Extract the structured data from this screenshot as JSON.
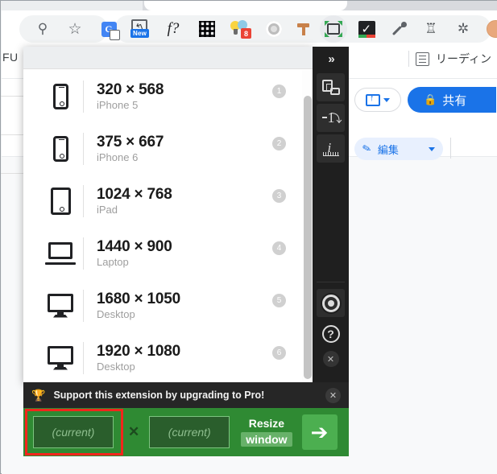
{
  "browser": {
    "toolbar_icons": [
      {
        "name": "search-icon",
        "glyph": "⌕"
      },
      {
        "name": "bookmark-star-icon",
        "glyph": "☆"
      },
      {
        "name": "google-translate-extension-icon",
        "label": "G"
      },
      {
        "name": "screenshot-extension-icon",
        "badge": "New"
      },
      {
        "name": "formula-extension-icon",
        "label": "f?"
      },
      {
        "name": "qr-code-extension-icon"
      },
      {
        "name": "lightbulb-extension-icon",
        "badge": "8"
      },
      {
        "name": "gear-extension-icon"
      },
      {
        "name": "hammer-extension-icon"
      },
      {
        "name": "window-resizer-extension-icon"
      },
      {
        "name": "checkmark-extension-icon"
      },
      {
        "name": "color-picker-extension-icon"
      },
      {
        "name": "clawmark-extension-icon"
      },
      {
        "name": "extensions-puzzle-icon"
      },
      {
        "name": "profile-avatar-icon"
      }
    ]
  },
  "page": {
    "left_label": "FU",
    "reading_list_label": "リーディン",
    "share_label": "共有",
    "share_lock_icon": "🔒",
    "edit_label": "編集",
    "edit_pencil_icon": "✎"
  },
  "popup": {
    "resolutions": [
      {
        "dimensions": "320 × 568",
        "device": "iPhone 5",
        "badge": "1",
        "icon": "phone-icon"
      },
      {
        "dimensions": "375 × 667",
        "device": "iPhone 6",
        "badge": "2",
        "icon": "phone-icon"
      },
      {
        "dimensions": "1024 × 768",
        "device": "iPad",
        "badge": "3",
        "icon": "tablet-icon"
      },
      {
        "dimensions": "1440 × 900",
        "device": "Laptop",
        "badge": "4",
        "icon": "laptop-icon"
      },
      {
        "dimensions": "1680 × 1050",
        "device": "Desktop",
        "badge": "5",
        "icon": "desktop-icon"
      },
      {
        "dimensions": "1920 × 1080",
        "device": "Desktop",
        "badge": "6",
        "icon": "desktop-icon"
      }
    ]
  },
  "side_toolbar": {
    "expand_label": "»",
    "buttons": [
      {
        "name": "arrange-windows-button"
      },
      {
        "name": "redirect-button"
      },
      {
        "name": "info-ruler-button"
      },
      {
        "name": "settings-gear-button"
      },
      {
        "name": "help-button"
      }
    ],
    "close_label": "✕"
  },
  "promo": {
    "trophy_icon": "🏆",
    "message": "Support this extension by upgrading to Pro!",
    "close_label": "✕"
  },
  "resize_bar": {
    "width_value": "(current)",
    "height_value": "(current)",
    "separator": "✕",
    "resize_label_top": "Resize",
    "resize_label_bottom": "window",
    "apply_icon": "➔",
    "highlight_color": "#f2261c",
    "bar_color": "#2f8a33"
  }
}
